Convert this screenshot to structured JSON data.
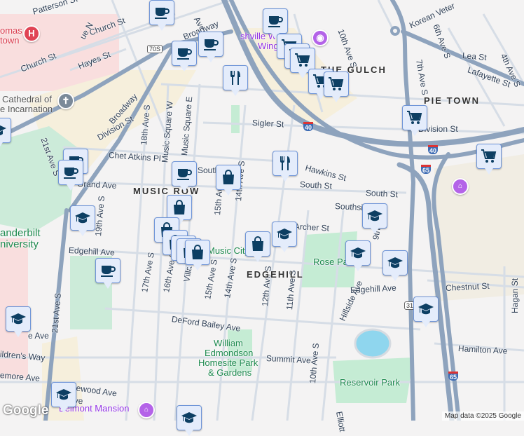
{
  "streets": {
    "patterson": "Patterson St",
    "ave_n_1": "ue N",
    "ave_n_2": "Ave N",
    "church1": "Church St",
    "church2": "Church St",
    "hayes": "Hayes St",
    "broadway1": "Broadway",
    "broadway2": "Broadway",
    "division1": "Division St",
    "division2": "Division St",
    "ave18": "18th Ave S",
    "msw": "Music Square W",
    "mse": "Music Square E",
    "chet": "Chet Atkins Pl",
    "ave21": "21st Ave S",
    "ave21b": "21st Ave S",
    "grand": "Grand Ave",
    "south_1": "South St",
    "south_2": "South St",
    "south_3": "South St",
    "southside": "Southside",
    "sigler": "Sigler St",
    "hawkins": "Hawkins St",
    "ave14": "14th Ave S",
    "ave15": "15th Ave S",
    "ave19": "19th Ave S",
    "edgehill1": "Edgehill Ave",
    "edgehill2": "Edgehill Ave",
    "archer": "Archer St",
    "ave17": "17th Ave S",
    "ave16": "16th Ave S",
    "villa": "Villa Pl",
    "ave15b": "15th Ave S",
    "ave14b": "14th Ave S",
    "deford": "DeFord Bailey Ave",
    "ave12": "12th Ave S",
    "ave11": "11th Ave S",
    "ave10": "10th Ave S",
    "ave10n": "10th Ave S",
    "ave9": "9th Ave",
    "hillside": "Hillside Ave",
    "chestnut": "Chestnut St",
    "hamilton": "Hamilton Ave",
    "hagan": "Hagan St",
    "summit": "Summit Ave",
    "wedgewood": "Wedgewood Ave",
    "childrens": "ildren's Way",
    "blakemore": "emore Ave",
    "pierce": "e Ave",
    "elliott": "Elliott",
    "korean": "Korean Veter",
    "ave6": "6th Ave S",
    "ave7": "7th Ave S",
    "ave4": "4th Ave S",
    "lea": "Lea St",
    "lafayette": "Lafayette St",
    "belmont": "t Ave"
  },
  "neighborhoods": {
    "music_row": "MUSIC ROW",
    "edgehill": "EDGEHILL",
    "gulch": "THE GULCH",
    "pie_town": "PIE TOWN"
  },
  "parks": {
    "rose": "Rose Park",
    "reservoir": "Reservoir Park",
    "william": "William",
    "edmondson": "Edmondson",
    "homesite": "Homesite Park",
    "gardens": "& Gardens",
    "vanderbilt1": "anderbilt",
    "vanderbilt2": "niversity"
  },
  "pois": {
    "hospital1": "omas",
    "hospital2": "town",
    "cathedral1": "Cathedral of",
    "cathedral2": "e Incarnation",
    "whales": "shville Wha",
    "wings": "Wings",
    "music_city": "Music City",
    "belmont": "Belmont Mansion"
  },
  "shields": {
    "us70s": "70S",
    "i40a": "40",
    "i40b": "40",
    "i65a": "65",
    "i65b": "65",
    "us31": "31"
  },
  "attribution": "Map data ©2025 Google",
  "logo": "Google",
  "marker_types": [
    "coffee",
    "coffee",
    "coffee",
    "coffee",
    "coffee",
    "coffee",
    "coffee",
    "coffee",
    "restaurant",
    "restaurant",
    "cart",
    "cart",
    "cart",
    "cart",
    "cart",
    "cart",
    "cart",
    "shopping-bag",
    "shopping-bag",
    "shopping-bag",
    "shopping-bag",
    "shopping-bag",
    "shopping-bag",
    "shopping-bag",
    "shopping-bag",
    "school",
    "school",
    "school",
    "school",
    "school",
    "school",
    "school",
    "school",
    "school",
    "school"
  ],
  "colors": {
    "highway": "#8ea3bd",
    "marker_bg": "#e4ecfb",
    "icon": "#0d3f63",
    "park": "#c5ecd4",
    "water": "#8fd6ee"
  }
}
